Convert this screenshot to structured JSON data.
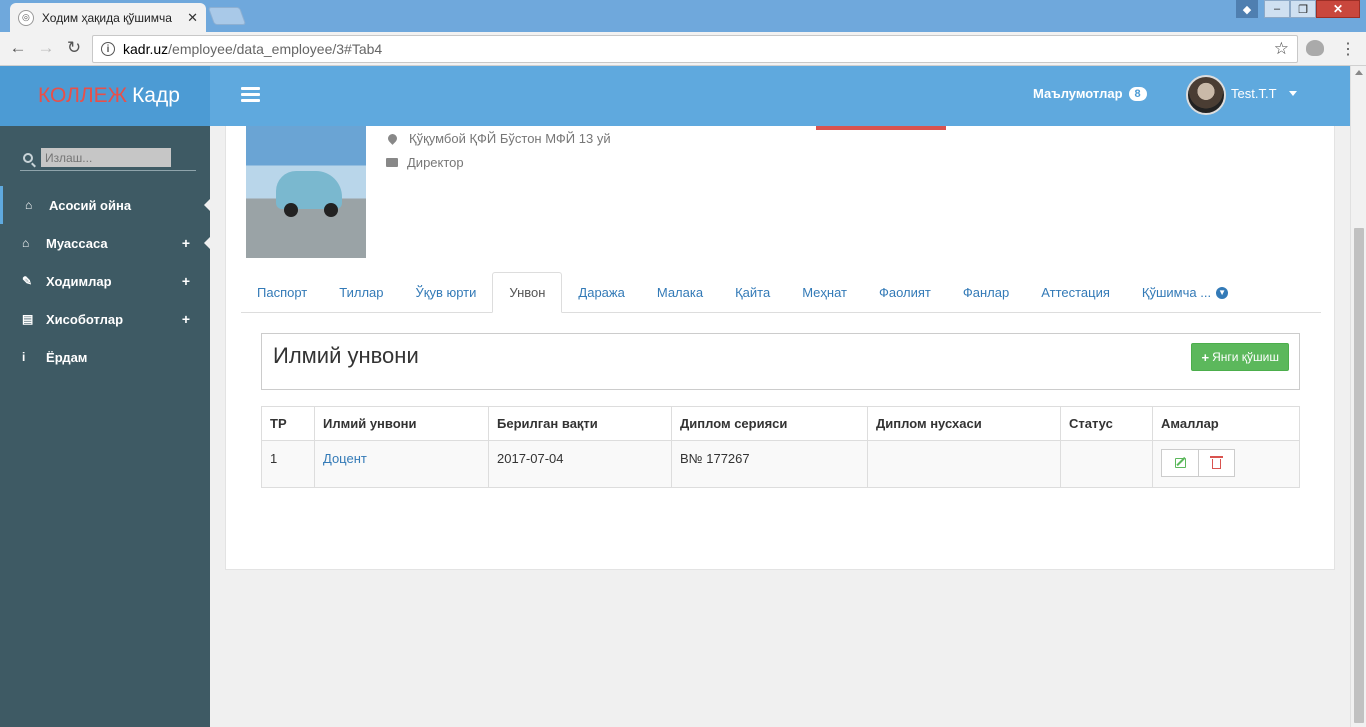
{
  "browser": {
    "tab_title": "Ходим ҳақида қўшимча",
    "tab_close": "✕",
    "url_domain": "kadr.uz",
    "url_path": "/employee/data_employee/3#Tab4"
  },
  "brand": {
    "part1": "КОЛЛЕЖ",
    "part2": "Кадр"
  },
  "header": {
    "notifications_label": "Маълумотлар",
    "notifications_count": "8",
    "user_name": "Test.T.T"
  },
  "sidebar": {
    "search_placeholder": "Излаш...",
    "items": [
      {
        "label": "Асосий ойна",
        "icon": "home-icon",
        "glyph": "⌂",
        "plus": ""
      },
      {
        "label": "Муассаса",
        "icon": "home-icon",
        "glyph": "⌂",
        "plus": "+"
      },
      {
        "label": "Ходимлар",
        "icon": "edit-icon",
        "glyph": "✎",
        "plus": "+"
      },
      {
        "label": "Хисоботлар",
        "icon": "table-icon",
        "glyph": "▤",
        "plus": "+"
      },
      {
        "label": "Ёрдам",
        "icon": "info-icon",
        "glyph": "i",
        "plus": ""
      }
    ]
  },
  "profile": {
    "address": "Қўқумбой ҚФЙ Бўстон МФЙ 13 уй",
    "position": "Директор"
  },
  "tabs": [
    {
      "label": "Паспорт"
    },
    {
      "label": "Тиллар"
    },
    {
      "label": "Ўқув юрти"
    },
    {
      "label": "Унвон"
    },
    {
      "label": "Даража"
    },
    {
      "label": "Малака"
    },
    {
      "label": "Қайта"
    },
    {
      "label": "Меҳнат"
    },
    {
      "label": "Фаолият"
    },
    {
      "label": "Фанлар"
    },
    {
      "label": "Аттестация"
    },
    {
      "label": "Қўшимча ..."
    }
  ],
  "active_tab": "Унвон",
  "section": {
    "title": "Илмий унвони",
    "add_button": "Янги қўшиш"
  },
  "table": {
    "headers": [
      "ТР",
      "Илмий унвони",
      "Берилган вақти",
      "Диплом серияси",
      "Диплом нусхаси",
      "Статус",
      "Амаллар"
    ],
    "rows": [
      {
        "num": "1",
        "title": "Доцент",
        "date": "2017-07-04",
        "series": "B№ 177267",
        "copy": "",
        "status": ""
      }
    ]
  },
  "colors": {
    "brand_bg": "#4c9bd4",
    "topnav_bg": "#5fa9de",
    "sidebar_bg": "#3e5a64",
    "accent_red": "#e8504a",
    "success": "#5cb85c",
    "link": "#337ab7"
  }
}
